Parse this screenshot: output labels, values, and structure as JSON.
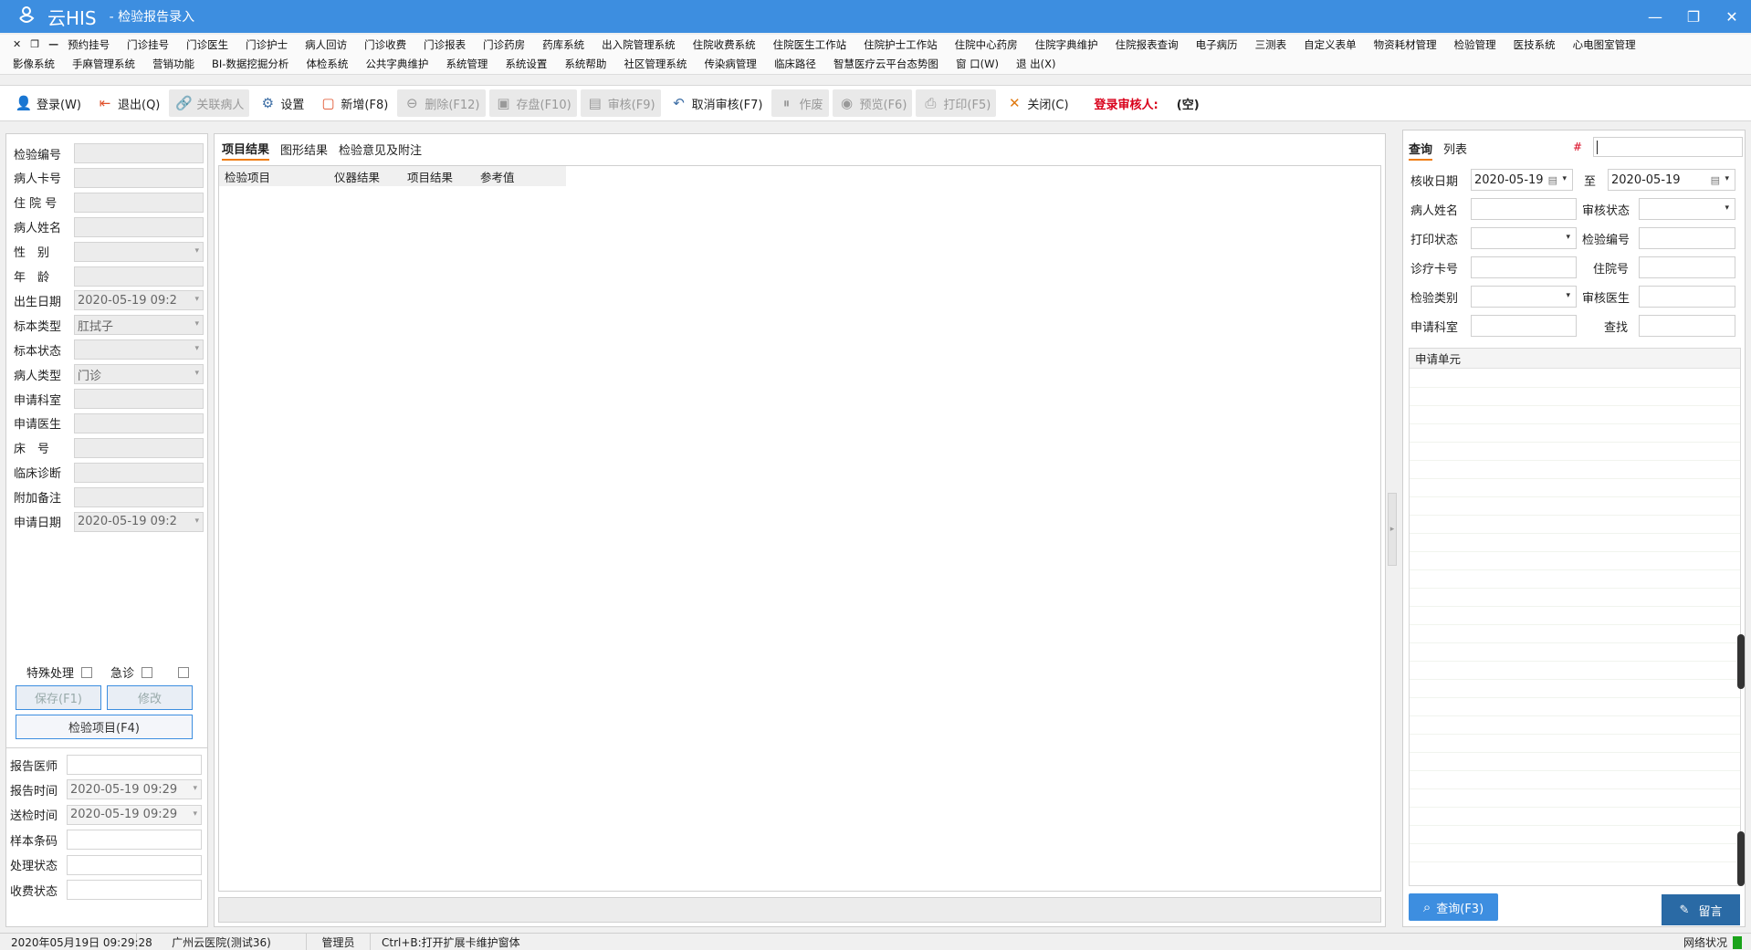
{
  "title_bar": {
    "app_name": "云HIS",
    "window_title": "- 检验报告录入",
    "minimize": "—",
    "restore": "❐",
    "close": "✕"
  },
  "menu": {
    "row1": [
      "预约挂号",
      "门诊挂号",
      "门诊医生",
      "门诊护士",
      "病人回访",
      "门诊收费",
      "门诊报表",
      "门诊药房",
      "药库系统",
      "出入院管理系统",
      "住院收费系统",
      "住院医生工作站",
      "住院护士工作站",
      "住院中心药房",
      "住院字典维护",
      "住院报表查询",
      "电子病历",
      "三测表",
      "自定义表单",
      "物资耗材管理",
      "检验管理",
      "医技系统",
      "心电图室管理"
    ],
    "row2": [
      "影像系统",
      "手麻管理系统",
      "营销功能",
      "BI-数据挖掘分析",
      "体检系统",
      "公共字典维护",
      "系统管理",
      "系统设置",
      "系统帮助",
      "社区管理系统",
      "传染病管理",
      "临床路径",
      "智慧医疗云平台态势图",
      "窗 口(W)",
      "退 出(X)"
    ]
  },
  "toolbar": {
    "login": "登录(W)",
    "logout": "退出(Q)",
    "link_patient": "关联病人",
    "settings": "设置",
    "add": "新增(F8)",
    "delete": "删除(F12)",
    "save": "存盘(F10)",
    "audit": "审核(F9)",
    "cancel_audit": "取消审核(F7)",
    "void": "作废",
    "preview": "预览(F6)",
    "print": "打印(F5)",
    "close": "关闭(C)",
    "login_auditor_label": "登录审核人:",
    "login_auditor_value": "(空)"
  },
  "left_form": {
    "fields": [
      {
        "label": "检验编号",
        "value": ""
      },
      {
        "label": "病人卡号",
        "value": ""
      },
      {
        "label": "住 院 号",
        "value": ""
      },
      {
        "label": "病人姓名",
        "value": ""
      },
      {
        "label": "性　别",
        "value": ""
      },
      {
        "label": "年　龄",
        "value": ""
      },
      {
        "label": "出生日期",
        "value": "2020-05-19 09:2"
      },
      {
        "label": "标本类型",
        "value": "肛拭子"
      },
      {
        "label": "标本状态",
        "value": ""
      },
      {
        "label": "病人类型",
        "value": "门诊"
      },
      {
        "label": "申请科室",
        "value": ""
      },
      {
        "label": "申请医生",
        "value": ""
      },
      {
        "label": "床　号",
        "value": ""
      },
      {
        "label": "临床诊断",
        "value": ""
      },
      {
        "label": "附加备注",
        "value": ""
      },
      {
        "label": "申请日期",
        "value": "2020-05-19 09:2"
      }
    ],
    "special_label": "特殊处理",
    "emergency_label": "急诊",
    "save_btn": "保存(F1)",
    "modify_btn": "修改",
    "items_btn": "检验项目(F4)",
    "report_fields": [
      {
        "label": "报告医师",
        "value": ""
      },
      {
        "label": "报告时间",
        "value": "2020-05-19 09:29"
      },
      {
        "label": "送检时间",
        "value": "2020-05-19 09:29"
      },
      {
        "label": "样本条码",
        "value": ""
      },
      {
        "label": "处理状态",
        "value": ""
      },
      {
        "label": "收费状态",
        "value": ""
      }
    ]
  },
  "center": {
    "tabs": [
      "项目结果",
      "图形结果",
      "检验意见及附注"
    ],
    "columns": [
      "检验项目",
      "仪器结果",
      "项目结果",
      "参考值"
    ]
  },
  "right": {
    "tabs": [
      "查询",
      "列表"
    ],
    "hash": "#",
    "receive_date_label": "核收日期",
    "date_from": "2020-05-19",
    "to_label": "至",
    "date_to": "2020-05-19",
    "patient_name_label": "病人姓名",
    "audit_status_label": "审核状态",
    "print_status_label": "打印状态",
    "test_no_label": "检验编号",
    "clinic_card_label": "诊疗卡号",
    "inpatient_no_label": "住院号",
    "test_category_label": "检验类别",
    "audit_doctor_label": "审核医生",
    "apply_dept_label": "申请科室",
    "find_label": "查找",
    "list_header": "申请单元",
    "query_btn": "查询(F3)",
    "message_btn": "留言"
  },
  "status_bar": {
    "datetime": "2020年05月19日 09:29:28",
    "hospital": "广州云医院(测试36)",
    "user": "管理员",
    "hint": "Ctrl+B:打开扩展卡维护窗体",
    "network": "网络状况"
  },
  "colors": {
    "title_bg": "#3d8ee0",
    "accent_tab": "#f07d12",
    "auditor_label": "#d9001b",
    "query_btn": "#3d8ee0"
  }
}
